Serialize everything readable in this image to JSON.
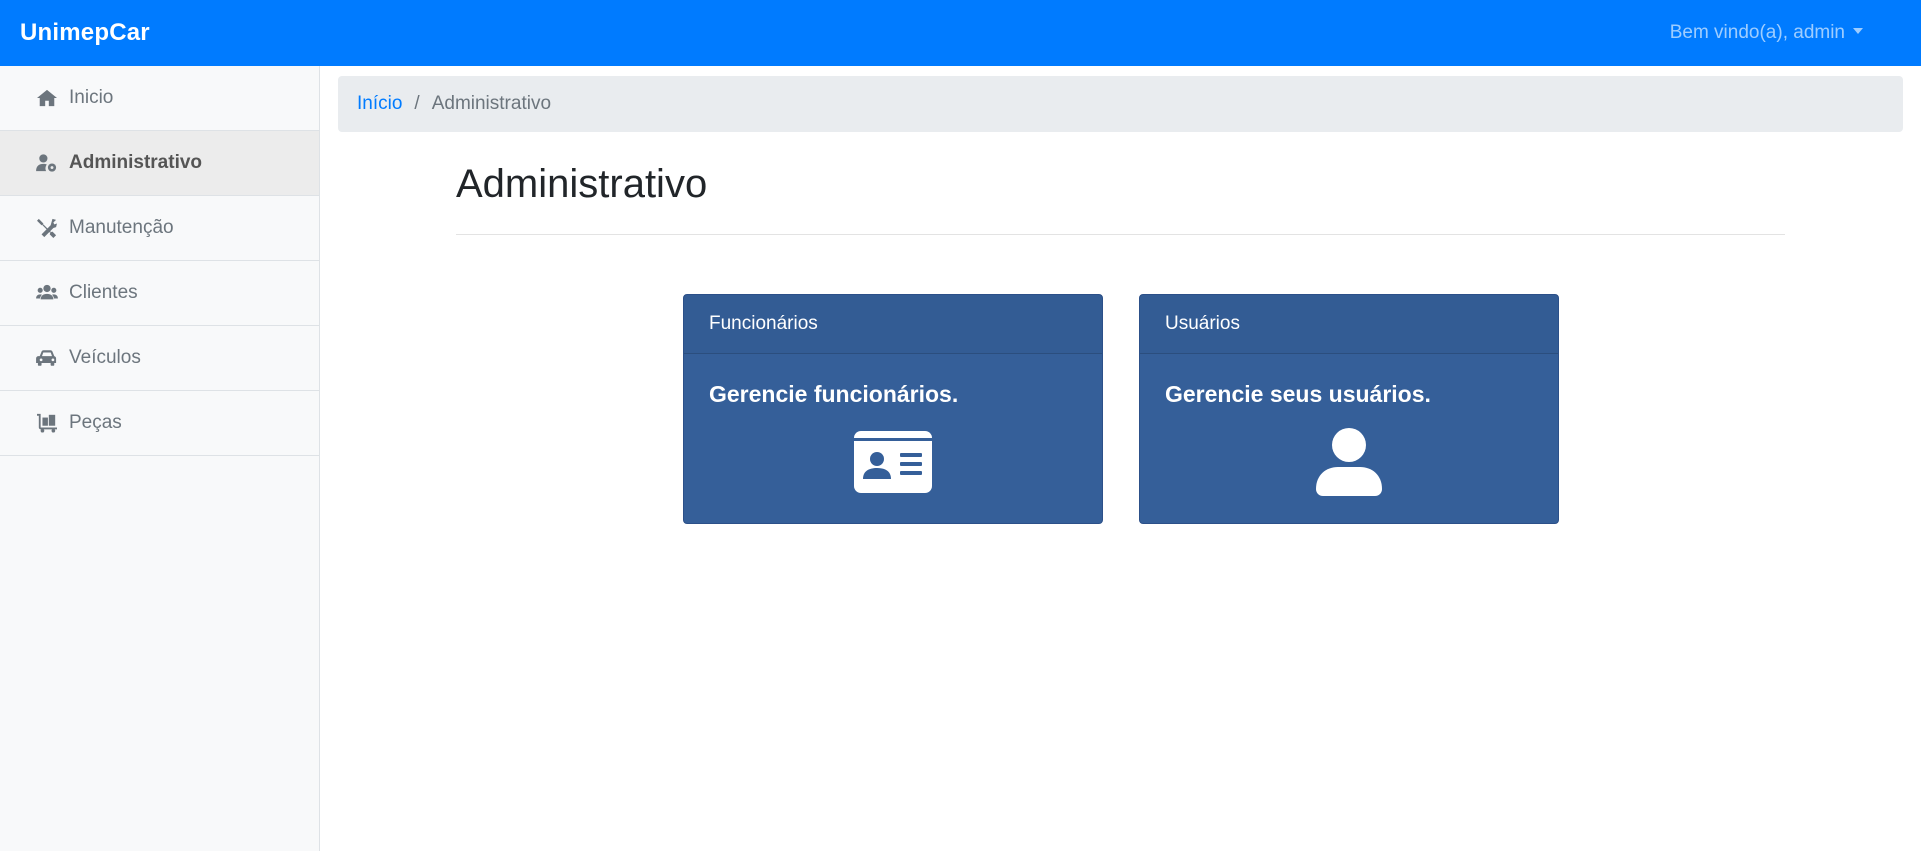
{
  "app": {
    "brand": "UnimepCar",
    "user_menu": "Bem vindo(a), admin"
  },
  "sidebar": {
    "items": [
      {
        "label": "Inicio",
        "icon": "home-icon",
        "active": false
      },
      {
        "label": "Administrativo",
        "icon": "user-cog-icon",
        "active": true
      },
      {
        "label": "Manutenção",
        "icon": "tools-icon",
        "active": false
      },
      {
        "label": "Clientes",
        "icon": "users-icon",
        "active": false
      },
      {
        "label": "Veículos",
        "icon": "car-icon",
        "active": false
      },
      {
        "label": "Peças",
        "icon": "dolly-icon",
        "active": false
      }
    ]
  },
  "breadcrumb": {
    "home": "Início",
    "separator": "/",
    "current": "Administrativo"
  },
  "main": {
    "title": "Administrativo",
    "cards": [
      {
        "header": "Funcionários",
        "text": "Gerencie funcionários.",
        "icon": "id-card-icon"
      },
      {
        "header": "Usuários",
        "text": "Gerencie seus usuários.",
        "icon": "user-icon"
      }
    ]
  },
  "colors": {
    "navbar": "#007bff",
    "card": "#355f99",
    "sidebar": "#f8f9fa",
    "link": "#007bff"
  }
}
